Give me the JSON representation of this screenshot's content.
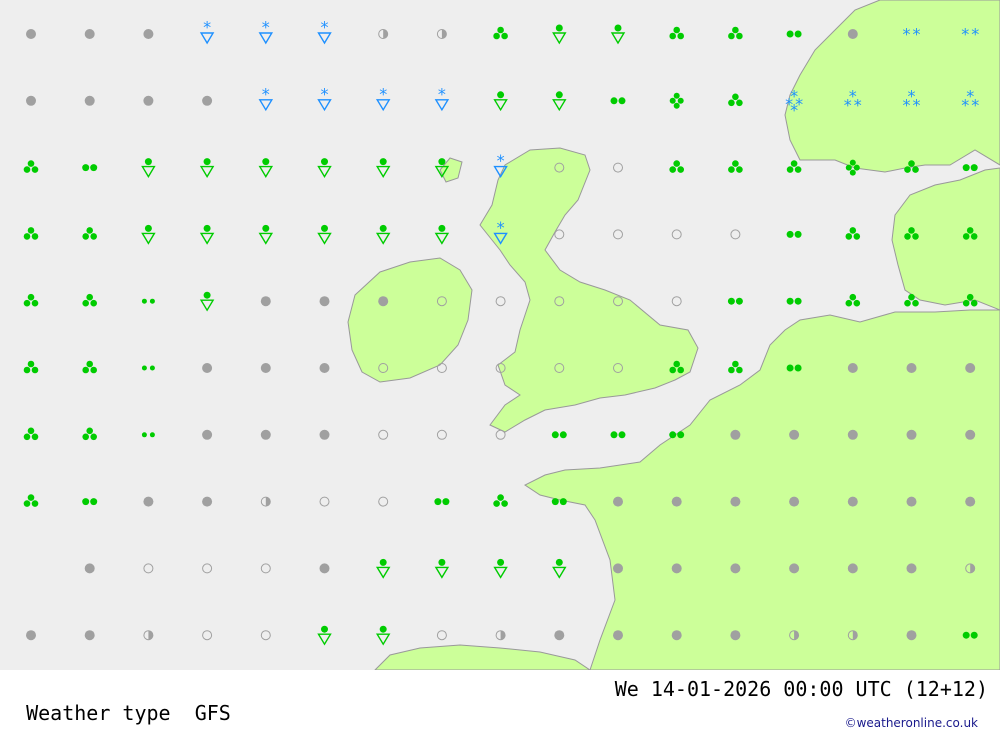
{
  "title": "Weather type",
  "model": "GFS",
  "datetime": "We 14-01-2026 00:00 UTC (12+12)",
  "credit": "©weatheronline.co.uk",
  "colors": {
    "sea": "#eeeeee",
    "land": "#ccff99",
    "coast": "#999999",
    "rain": "#00cc00",
    "snow": "#1e90ff",
    "cloud": "#a0a0a0"
  },
  "symbol_rows": [
    [
      "cloud",
      "cloud",
      "cloud",
      "snow-shower",
      "snow-shower",
      "snow-shower",
      "half-cloud",
      "half-cloud",
      "rain-heavy",
      "shower",
      "shower",
      "rain-heavy",
      "rain-heavy",
      "rain-light",
      "cloud",
      "snow-double",
      "snow-double"
    ],
    [
      "cloud",
      "cloud",
      "cloud",
      "cloud",
      "snow-shower",
      "snow-shower",
      "snow-shower",
      "snow-shower",
      "shower",
      "shower",
      "rain-light",
      "sleet",
      "rain-heavy",
      "snow-heavy",
      "snow-triple",
      "snow-triple",
      "snow-triple"
    ],
    [
      "rain-heavy",
      "rain-light",
      "shower",
      "shower",
      "shower",
      "shower",
      "shower",
      "shower",
      "snow-shower",
      "clear",
      "clear",
      "rain-heavy",
      "rain-heavy",
      "rain-heavy",
      "sleet",
      "rain-heavy",
      "rain-light"
    ],
    [
      "rain-heavy",
      "rain-heavy",
      "shower",
      "shower",
      "shower",
      "shower",
      "shower",
      "shower",
      "snow-shower",
      "clear",
      "clear",
      "clear",
      "clear",
      "rain-light",
      "rain-heavy",
      "rain-heavy",
      "rain-heavy"
    ],
    [
      "rain-heavy",
      "rain-heavy",
      "drizzle",
      "shower",
      "cloud",
      "cloud",
      "cloud",
      "clear",
      "clear",
      "clear",
      "clear",
      "clear",
      "rain-light",
      "rain-light",
      "rain-heavy",
      "rain-heavy",
      "rain-heavy"
    ],
    [
      "rain-heavy",
      "rain-heavy",
      "drizzle",
      "cloud",
      "cloud",
      "cloud",
      "clear",
      "clear",
      "clear",
      "clear",
      "clear",
      "rain-heavy",
      "rain-heavy",
      "rain-light",
      "cloud",
      "cloud",
      "cloud"
    ],
    [
      "rain-heavy",
      "rain-heavy",
      "drizzle",
      "cloud",
      "cloud",
      "cloud",
      "clear",
      "clear",
      "clear",
      "rain-light",
      "rain-light",
      "rain-light",
      "cloud",
      "cloud",
      "cloud",
      "cloud",
      "cloud"
    ],
    [
      "rain-heavy",
      "rain-light",
      "cloud",
      "cloud",
      "half-cloud",
      "clear",
      "clear",
      "rain-light",
      "rain-heavy",
      "rain-light",
      "cloud",
      "cloud",
      "cloud",
      "cloud",
      "cloud",
      "cloud",
      "cloud"
    ],
    [
      "none",
      "cloud",
      "clear",
      "clear",
      "clear",
      "cloud",
      "shower",
      "shower",
      "shower",
      "shower",
      "cloud",
      "cloud",
      "cloud",
      "cloud",
      "cloud",
      "cloud",
      "half-cloud"
    ],
    [
      "cloud",
      "cloud",
      "half-cloud",
      "clear",
      "clear",
      "shower",
      "shower",
      "clear",
      "half-cloud",
      "cloud",
      "cloud",
      "cloud",
      "cloud",
      "half-cloud",
      "half-cloud",
      "cloud",
      "rain-light"
    ]
  ]
}
